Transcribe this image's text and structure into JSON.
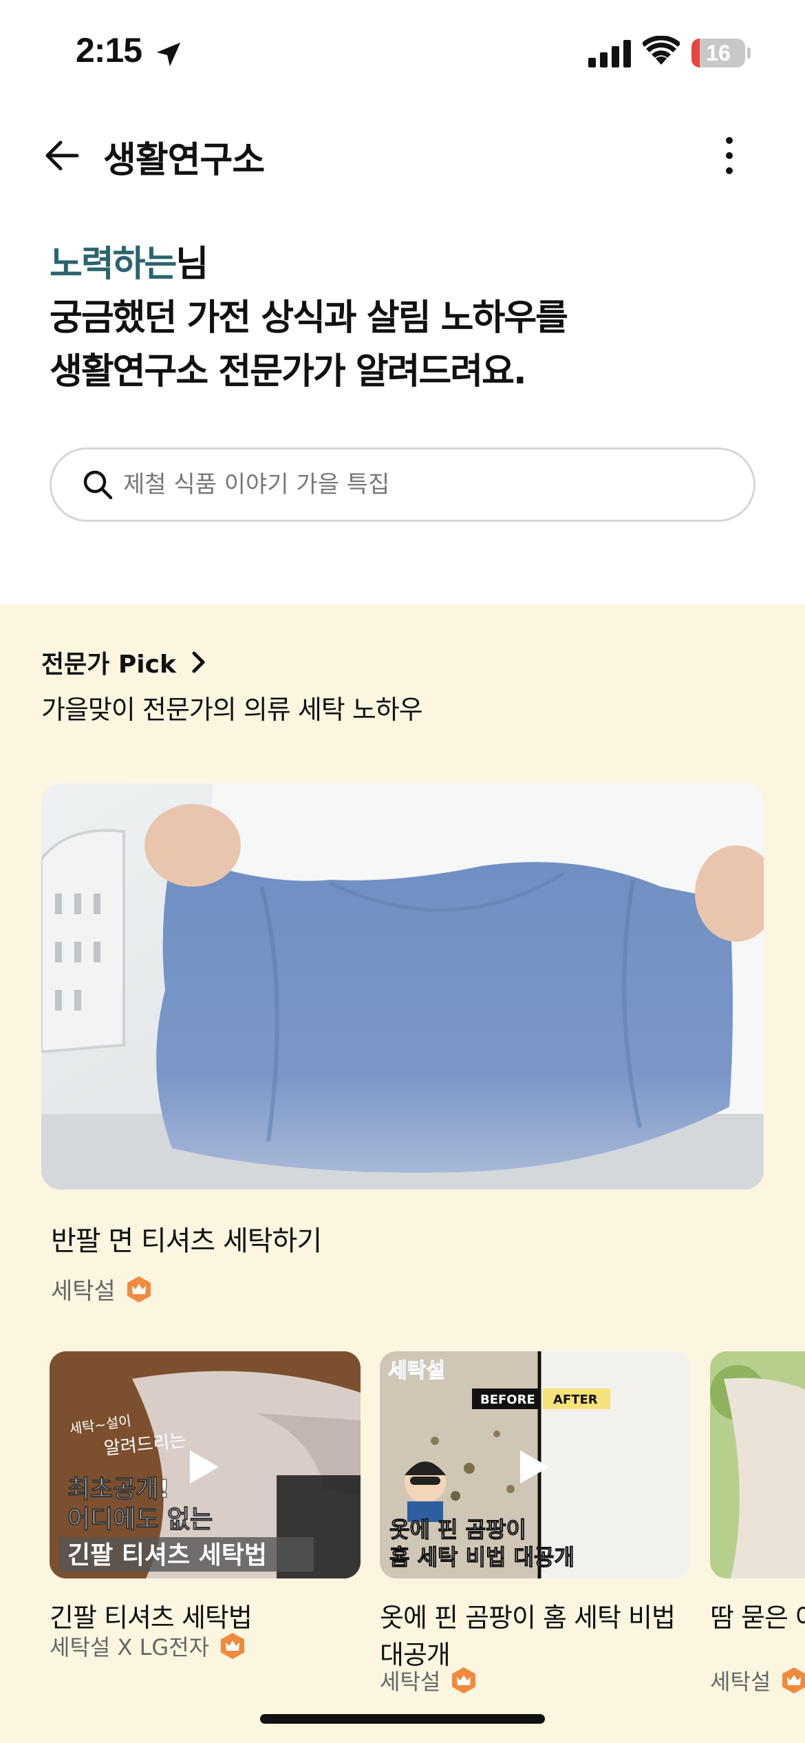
{
  "status": {
    "time": "2:15",
    "battery": "16",
    "battery_level": 0.16
  },
  "header": {
    "title": "생활연구소"
  },
  "greeting": {
    "name": "노력하는",
    "suffix": "님",
    "line2": "궁금했던 가전 상식과 살림 노하우를",
    "line3": "생활연구소 전문가가 알려드려요."
  },
  "search": {
    "placeholder": "제철 식품 이야기 가을 특집"
  },
  "pick": {
    "header": "전문가 Pick",
    "subtitle": "가을맞이 전문가의 의류 세탁 노하우",
    "hero": {
      "title": "반팔 면 티셔츠 세탁하기",
      "author": "세탁설"
    },
    "cards": [
      {
        "title": "긴팔 티셔츠 세탁법",
        "author": "세탁설 X LG전자",
        "thumb_text": [
          "세탁~설이",
          "알려드리는",
          "최초공개!",
          "어디에도 없는",
          "긴팔 티셔츠 세탁법"
        ]
      },
      {
        "title": "옷에 핀 곰팡이 홈 세탁 비법 대공개",
        "author": "세탁설",
        "thumb_text": [
          "세탁설",
          "BEFORE",
          "AFTER",
          "옷에 핀 곰팡이",
          "홈 세탁 비법 대공개"
        ]
      },
      {
        "title": "땀 묻은 여름옷 표백 방법",
        "author": "세탁설",
        "thumb_text": []
      }
    ]
  },
  "colors": {
    "accent": "#2b6470",
    "section_bg": "#fcf6e1",
    "crown": "#f08a3c"
  }
}
